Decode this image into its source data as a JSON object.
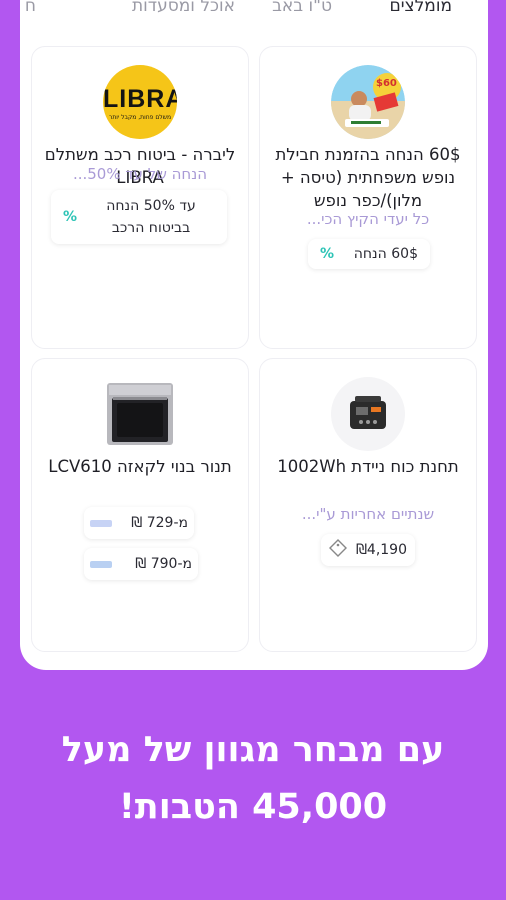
{
  "tabs": {
    "recommended": "מומלצים",
    "tu_bav": "ט\"ו באב",
    "food": "אוכל ומסעדות",
    "partial": "ח"
  },
  "offers": [
    {
      "title": "60$ הנחה בהזמנת חבילת נופש משפחתית (טיסה + מלון)/כפר נופש",
      "subtitle": "כל יעדי הקיץ הכי...",
      "chip_text": "60$ הנחה",
      "chip_icon": "%",
      "badge_text": "$60"
    },
    {
      "title": "ליברה - ביטוח רכב משתלם LIBRA",
      "subtitle": "הנחה של עד 50%...",
      "chip_text": "עד 50% הנחה בביטוח הרכב",
      "chip_icon": "%",
      "logo_text": "LIBRA",
      "logo_sub": "משלם פחות, מקבל יותר",
      "logo_color": "#f5c518"
    },
    {
      "title": "תחנת כוח ניידת 1002Wh",
      "subtitle": "שנתיים אחריות ע\"י...",
      "chip_text": "₪4,190",
      "chip_icon": "price-tag-icon"
    },
    {
      "title": "תנור בנוי לקאזה LCV610",
      "price_rows": [
        {
          "label": "מ-729 ₪"
        },
        {
          "label": "מ-790 ₪"
        }
      ]
    }
  ],
  "headline": {
    "line1": "עם מבחר מגוון של מעל",
    "line2": "45,000 הטבות!"
  },
  "colors": {
    "background": "#b257f0",
    "accent_text": "#a99ad6",
    "percent": "#2ec4b6"
  }
}
